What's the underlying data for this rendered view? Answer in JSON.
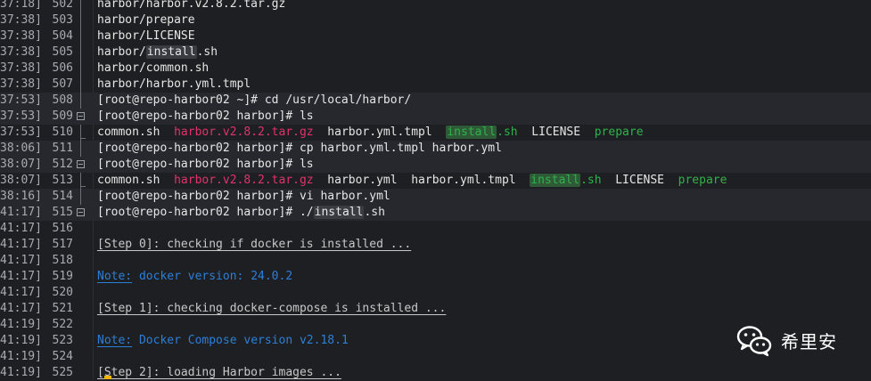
{
  "lines": [
    {
      "ts": "37:18]",
      "ln": "502",
      "parts": [
        [
          "w",
          "harbor/harbor.v2.8.2.tar.gz"
        ]
      ]
    },
    {
      "ts": "37:38]",
      "ln": "503",
      "parts": [
        [
          "w",
          "harbor/prepare"
        ]
      ]
    },
    {
      "ts": "37:38]",
      "ln": "504",
      "parts": [
        [
          "w",
          "harbor/LICENSE"
        ]
      ]
    },
    {
      "ts": "37:38]",
      "ln": "505",
      "parts": [
        [
          "w",
          "harbor/"
        ],
        [
          "mark",
          "install"
        ],
        [
          "w",
          ".sh"
        ]
      ]
    },
    {
      "ts": "37:38]",
      "ln": "506",
      "parts": [
        [
          "w",
          "harbor/common.sh"
        ]
      ]
    },
    {
      "ts": "37:38]",
      "ln": "507",
      "parts": [
        [
          "w",
          "harbor/harbor.yml.tmpl"
        ]
      ]
    },
    {
      "ts": "37:53]",
      "ln": "508",
      "hl": true,
      "parts": [
        [
          "w",
          "[root@repo-harbor02 ~]# cd /usr/local/harbor/"
        ]
      ]
    },
    {
      "ts": "37:53]",
      "ln": "509",
      "fold": true,
      "hl": true,
      "parts": [
        [
          "w",
          "[root@repo-harbor02 harbor]# ls"
        ]
      ]
    },
    {
      "ts": "37:53]",
      "ln": "510",
      "end": true,
      "parts": [
        [
          "w",
          "common.sh  "
        ],
        [
          "red",
          "harbor.v2.8.2.tar.gz"
        ],
        [
          "w",
          "  harbor.yml.tmpl  "
        ],
        [
          "markg",
          "install"
        ],
        [
          "green",
          ".sh"
        ],
        [
          "w",
          "  LICENSE  "
        ],
        [
          "green",
          "prepare"
        ]
      ]
    },
    {
      "ts": "38:06]",
      "ln": "511",
      "hl": true,
      "parts": [
        [
          "w",
          "[root@repo-harbor02 harbor]# cp harbor.yml.tmpl harbor.yml"
        ]
      ]
    },
    {
      "ts": "38:07]",
      "ln": "512",
      "fold": true,
      "hl": true,
      "parts": [
        [
          "w",
          "[root@repo-harbor02 harbor]# ls"
        ]
      ]
    },
    {
      "ts": "38:07]",
      "ln": "513",
      "end": true,
      "parts": [
        [
          "w",
          "common.sh  "
        ],
        [
          "red",
          "harbor.v2.8.2.tar.gz"
        ],
        [
          "w",
          "  harbor.yml  harbor.yml.tmpl  "
        ],
        [
          "markg",
          "install"
        ],
        [
          "green",
          ".sh"
        ],
        [
          "w",
          "  LICENSE  "
        ],
        [
          "green",
          "prepare"
        ]
      ]
    },
    {
      "ts": "38:16]",
      "ln": "514",
      "hl": true,
      "parts": [
        [
          "w",
          "[root@repo-harbor02 harbor]# vi harbor.yml"
        ]
      ]
    },
    {
      "ts": "41:17]",
      "ln": "515",
      "fold": true,
      "hl": true,
      "parts": [
        [
          "w",
          "[root@repo-harbor02 harbor]# ./"
        ],
        [
          "mark",
          "install"
        ],
        [
          "w",
          ".sh"
        ]
      ]
    },
    {
      "ts": "41:17]",
      "ln": "516",
      "parts": []
    },
    {
      "ts": "41:17]",
      "ln": "517",
      "parts": [
        [
          "grey",
          "[Step 0]: checking if docker is installed ..."
        ]
      ]
    },
    {
      "ts": "41:17]",
      "ln": "518",
      "parts": []
    },
    {
      "ts": "41:17]",
      "ln": "519",
      "parts": [
        [
          "blueu",
          "Note:"
        ],
        [
          "blue",
          " docker version: 24.0.2"
        ]
      ]
    },
    {
      "ts": "41:17]",
      "ln": "520",
      "parts": []
    },
    {
      "ts": "41:17]",
      "ln": "521",
      "parts": [
        [
          "grey",
          "[Step 1]: checking docker-compose is installed ..."
        ]
      ]
    },
    {
      "ts": "41:19]",
      "ln": "522",
      "parts": []
    },
    {
      "ts": "41:19]",
      "ln": "523",
      "parts": [
        [
          "blueu",
          "Note:"
        ],
        [
          "blue",
          " Docker Compose version v2.18.1"
        ]
      ]
    },
    {
      "ts": "41:19]",
      "ln": "524",
      "parts": []
    },
    {
      "ts": "41:19]",
      "ln": "525",
      "parts": [
        [
          "grey",
          "[Step 2]: loading Harbor images ..."
        ]
      ]
    }
  ],
  "watermark": {
    "text": "希里安",
    "icon": "wechat-icon"
  },
  "colors": {
    "background": "#1e1f22",
    "red": "#e0336b",
    "green": "#2fb24b",
    "blue": "#2c7fd6",
    "cursor": "#f2b400"
  }
}
